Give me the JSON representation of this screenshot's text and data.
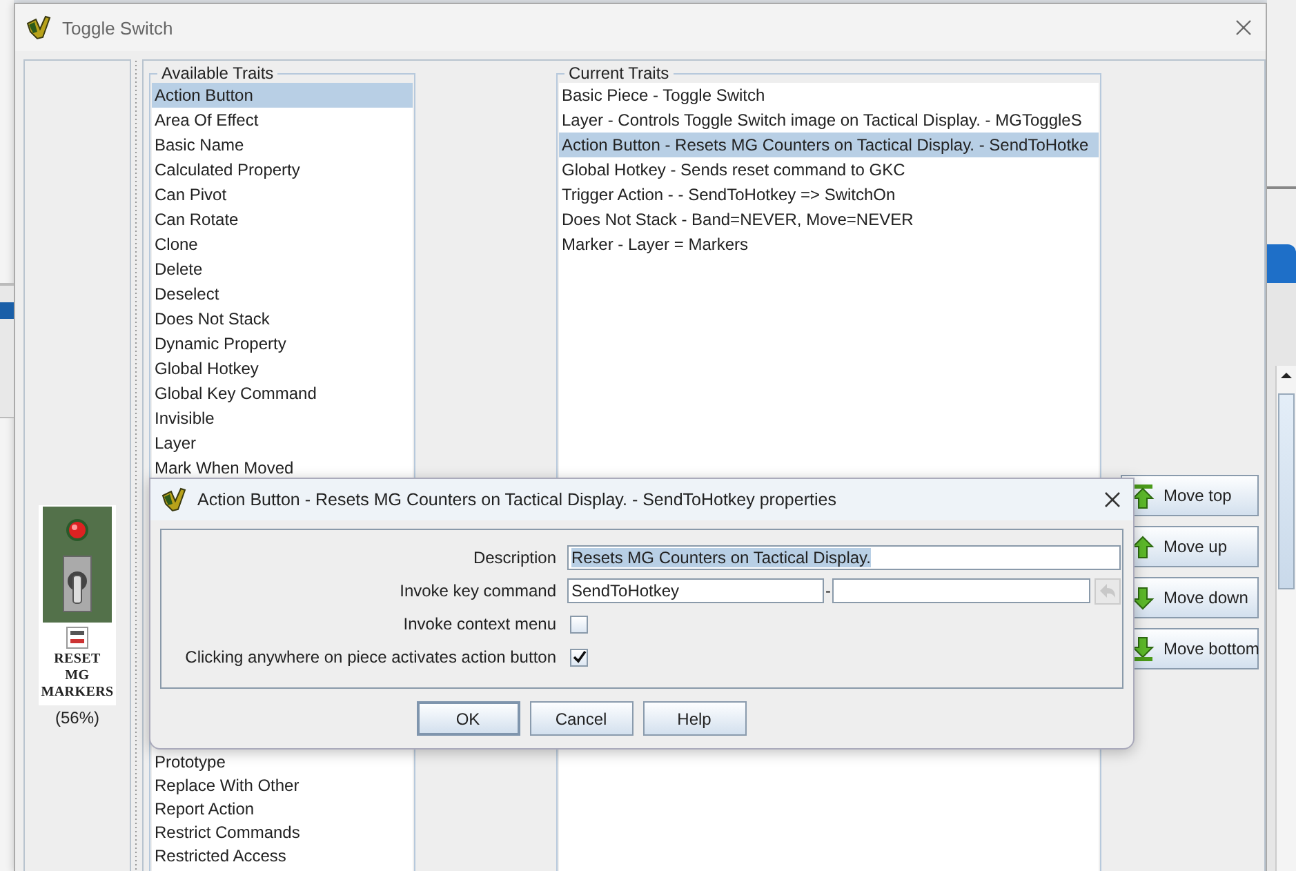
{
  "window": {
    "title": "Toggle Switch"
  },
  "piece": {
    "label": "RESET\nMG\nMARKERS",
    "zoom": "(56%)"
  },
  "available_traits": {
    "title": "Available Traits",
    "items": [
      {
        "label": "Action Button",
        "selected": true
      },
      {
        "label": "Area Of Effect",
        "selected": false
      },
      {
        "label": "Basic Name",
        "selected": false
      },
      {
        "label": "Calculated Property",
        "selected": false
      },
      {
        "label": "Can Pivot",
        "selected": false
      },
      {
        "label": "Can Rotate",
        "selected": false
      },
      {
        "label": "Clone",
        "selected": false
      },
      {
        "label": "Delete",
        "selected": false
      },
      {
        "label": "Deselect",
        "selected": false
      },
      {
        "label": "Does Not Stack",
        "selected": false
      },
      {
        "label": "Dynamic Property",
        "selected": false
      },
      {
        "label": "Global Hotkey",
        "selected": false
      },
      {
        "label": "Global Key Command",
        "selected": false
      },
      {
        "label": "Invisible",
        "selected": false
      },
      {
        "label": "Layer",
        "selected": false
      },
      {
        "label": "Mark When Moved",
        "selected": false
      },
      {
        "label": "Prototype",
        "selected": false
      },
      {
        "label": "Replace With Other",
        "selected": false
      },
      {
        "label": "Report Action",
        "selected": false
      },
      {
        "label": "Restrict Commands",
        "selected": false
      },
      {
        "label": "Restricted Access",
        "selected": false
      }
    ]
  },
  "current_traits": {
    "title": "Current Traits",
    "items": [
      {
        "label": "Basic Piece - Toggle Switch",
        "selected": false
      },
      {
        "label": "Layer - Controls Toggle Switch image on Tactical Display. - MGToggleS",
        "selected": false
      },
      {
        "label": "Action Button - Resets MG Counters on Tactical Display. - SendToHotke",
        "selected": true
      },
      {
        "label": "Global Hotkey - Sends reset command to GKC",
        "selected": false
      },
      {
        "label": "Trigger Action -  - SendToHotkey => SwitchOn",
        "selected": false
      },
      {
        "label": "Does Not Stack - Band=NEVER, Move=NEVER",
        "selected": false
      },
      {
        "label": "Marker - Layer = Markers",
        "selected": false
      }
    ]
  },
  "move_buttons": [
    {
      "kind": "top",
      "label": "Move top"
    },
    {
      "kind": "up",
      "label": "Move up"
    },
    {
      "kind": "down",
      "label": "Move down"
    },
    {
      "kind": "bottom",
      "label": "Move bottom"
    }
  ],
  "dialog": {
    "title": "Action Button - Resets MG Counters on Tactical Display. - SendToHotkey properties",
    "fields": [
      {
        "kind": "text",
        "label": "Description",
        "value": "Resets MG Counters on Tactical Display.",
        "highlighted": true
      },
      {
        "kind": "keystroke",
        "label": "Invoke key command",
        "value": "SendToHotkey",
        "separator": "-"
      },
      {
        "kind": "checkbox",
        "label": "Invoke context menu",
        "checked": false
      },
      {
        "kind": "checkbox",
        "label": "Clicking anywhere on piece activates action button",
        "checked": true
      }
    ],
    "buttons": [
      {
        "label": "OK",
        "focused": true
      },
      {
        "label": "Cancel",
        "focused": false
      },
      {
        "label": "Help",
        "focused": false
      }
    ]
  }
}
